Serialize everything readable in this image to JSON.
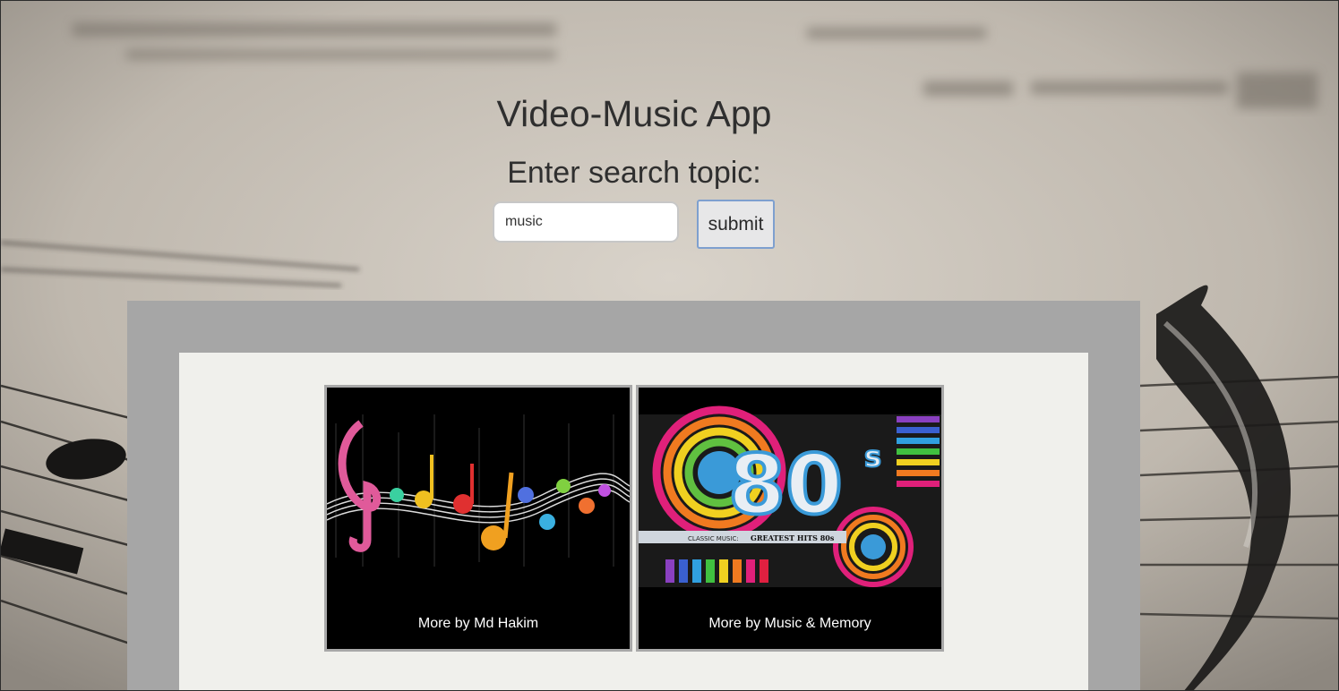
{
  "app": {
    "title": "Video-Music App"
  },
  "search": {
    "label": "Enter search topic:",
    "value": "music",
    "submit_label": "submit"
  },
  "results": [
    {
      "caption": "More by Md Hakim",
      "thumbnail": "colorful-music-notes-icon"
    },
    {
      "caption": "More by Music & Memory",
      "thumbnail": "greatest-hits-80s-icon",
      "thumb_text_small": "CLASSIC MUSIC:",
      "thumb_text_bold": "GREATEST HITS 80s",
      "thumb_big_text": "80",
      "thumb_sup_text": "s"
    }
  ],
  "colors": {
    "outer_panel": "#a6a6a6",
    "inner_panel": "#f0f0ec",
    "submit_border": "#7ea0cf"
  }
}
